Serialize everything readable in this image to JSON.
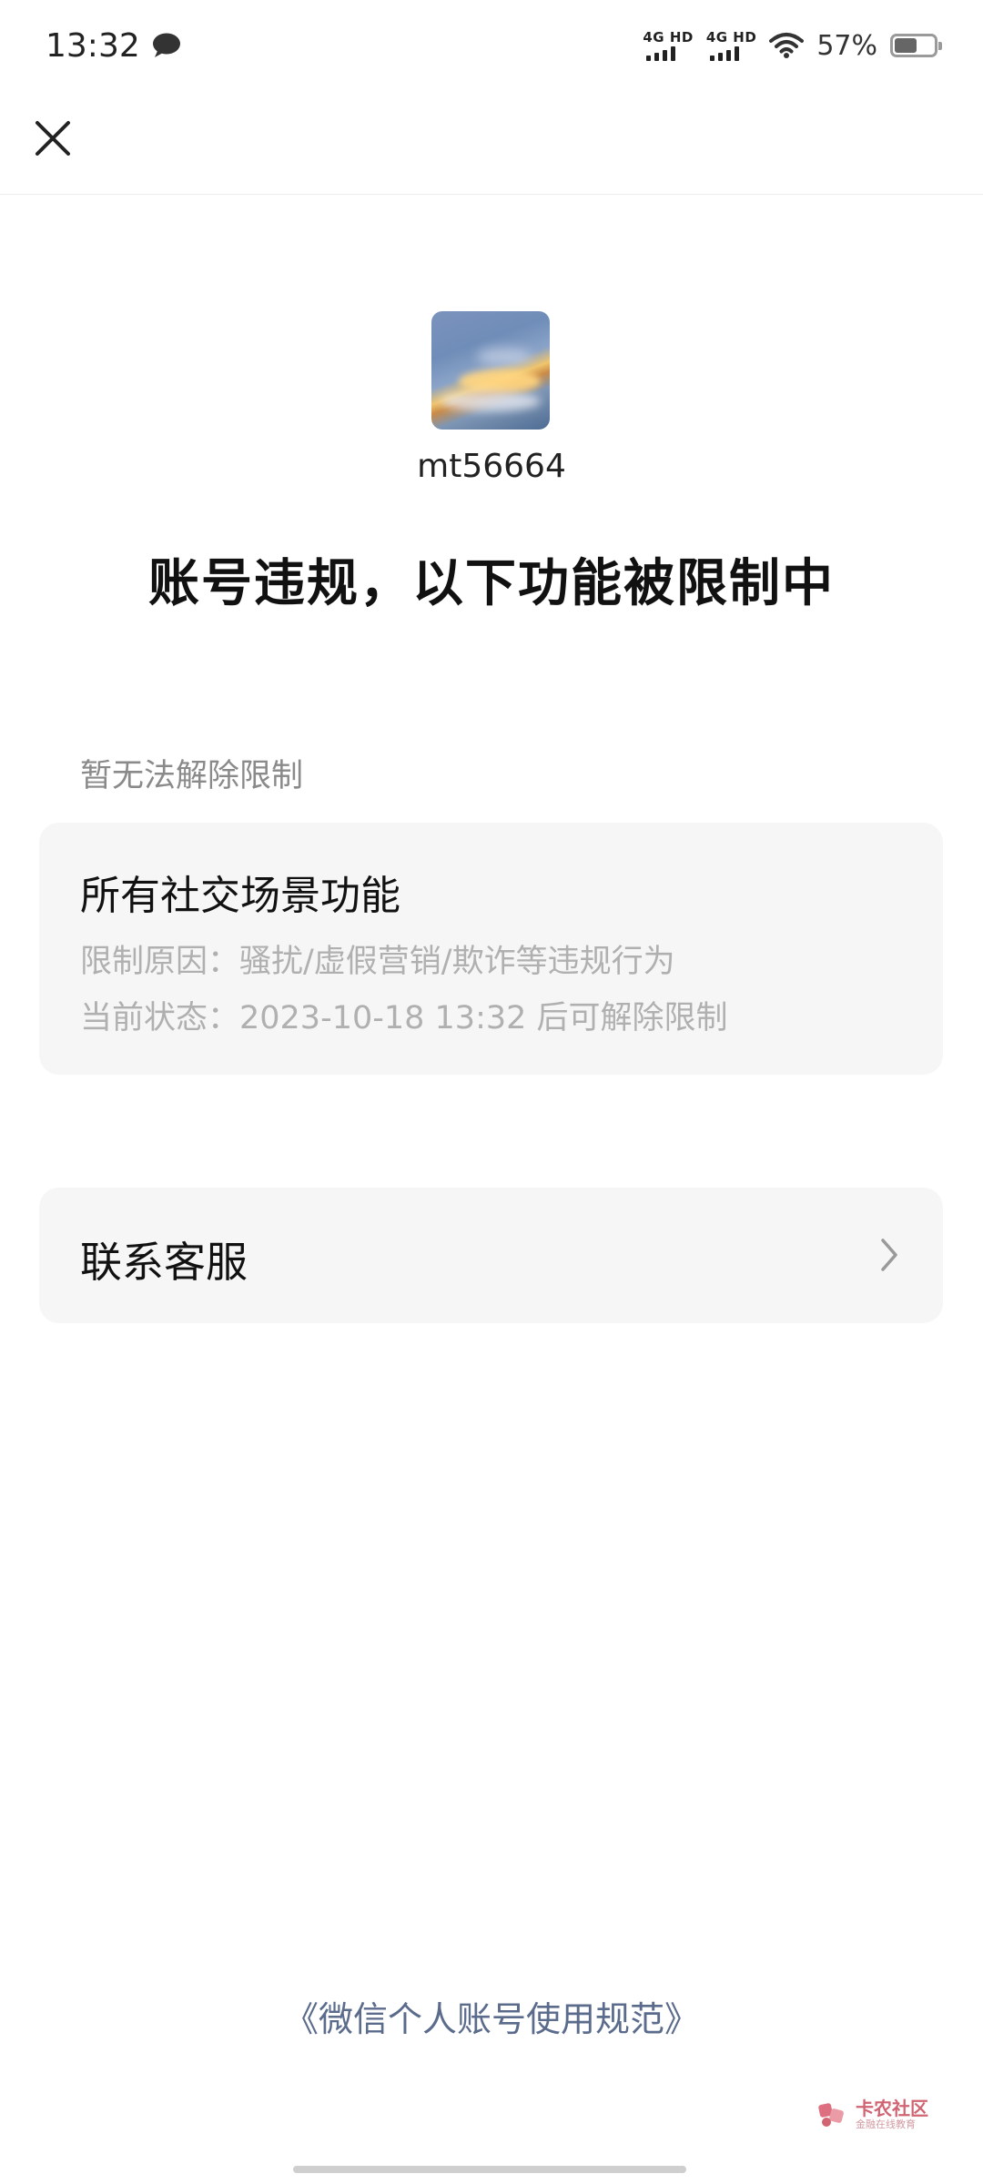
{
  "status_bar": {
    "time": "13:32",
    "network_1": "4G HD",
    "network_2": "4G HD",
    "battery_percent": "57%",
    "battery_level": 0.57,
    "icons": [
      "chat-bubble-icon",
      "signal-icon",
      "wifi-icon",
      "battery-icon"
    ]
  },
  "nav": {
    "close_icon": "close-icon"
  },
  "profile": {
    "username": "mt56664"
  },
  "headline": "账号违规，以下功能被限制中",
  "restriction_section": {
    "label": "暂无法解除限制",
    "card": {
      "title": "所有社交场景功能",
      "reason": "限制原因：骚扰/虚假营销/欺诈等违规行为",
      "status": "当前状态：2023-10-18 13:32 后可解除限制"
    }
  },
  "contact": {
    "label": "联系客服",
    "icon": "chevron-right-icon"
  },
  "footer": {
    "policy_link": "《微信个人账号使用规范》"
  },
  "watermark": {
    "main": "卡农社区",
    "sub": "金融在线教育"
  },
  "colors": {
    "card_background": "#f6f6f6",
    "link": "#5b6b8c",
    "muted_text": "#b0b0b0"
  }
}
